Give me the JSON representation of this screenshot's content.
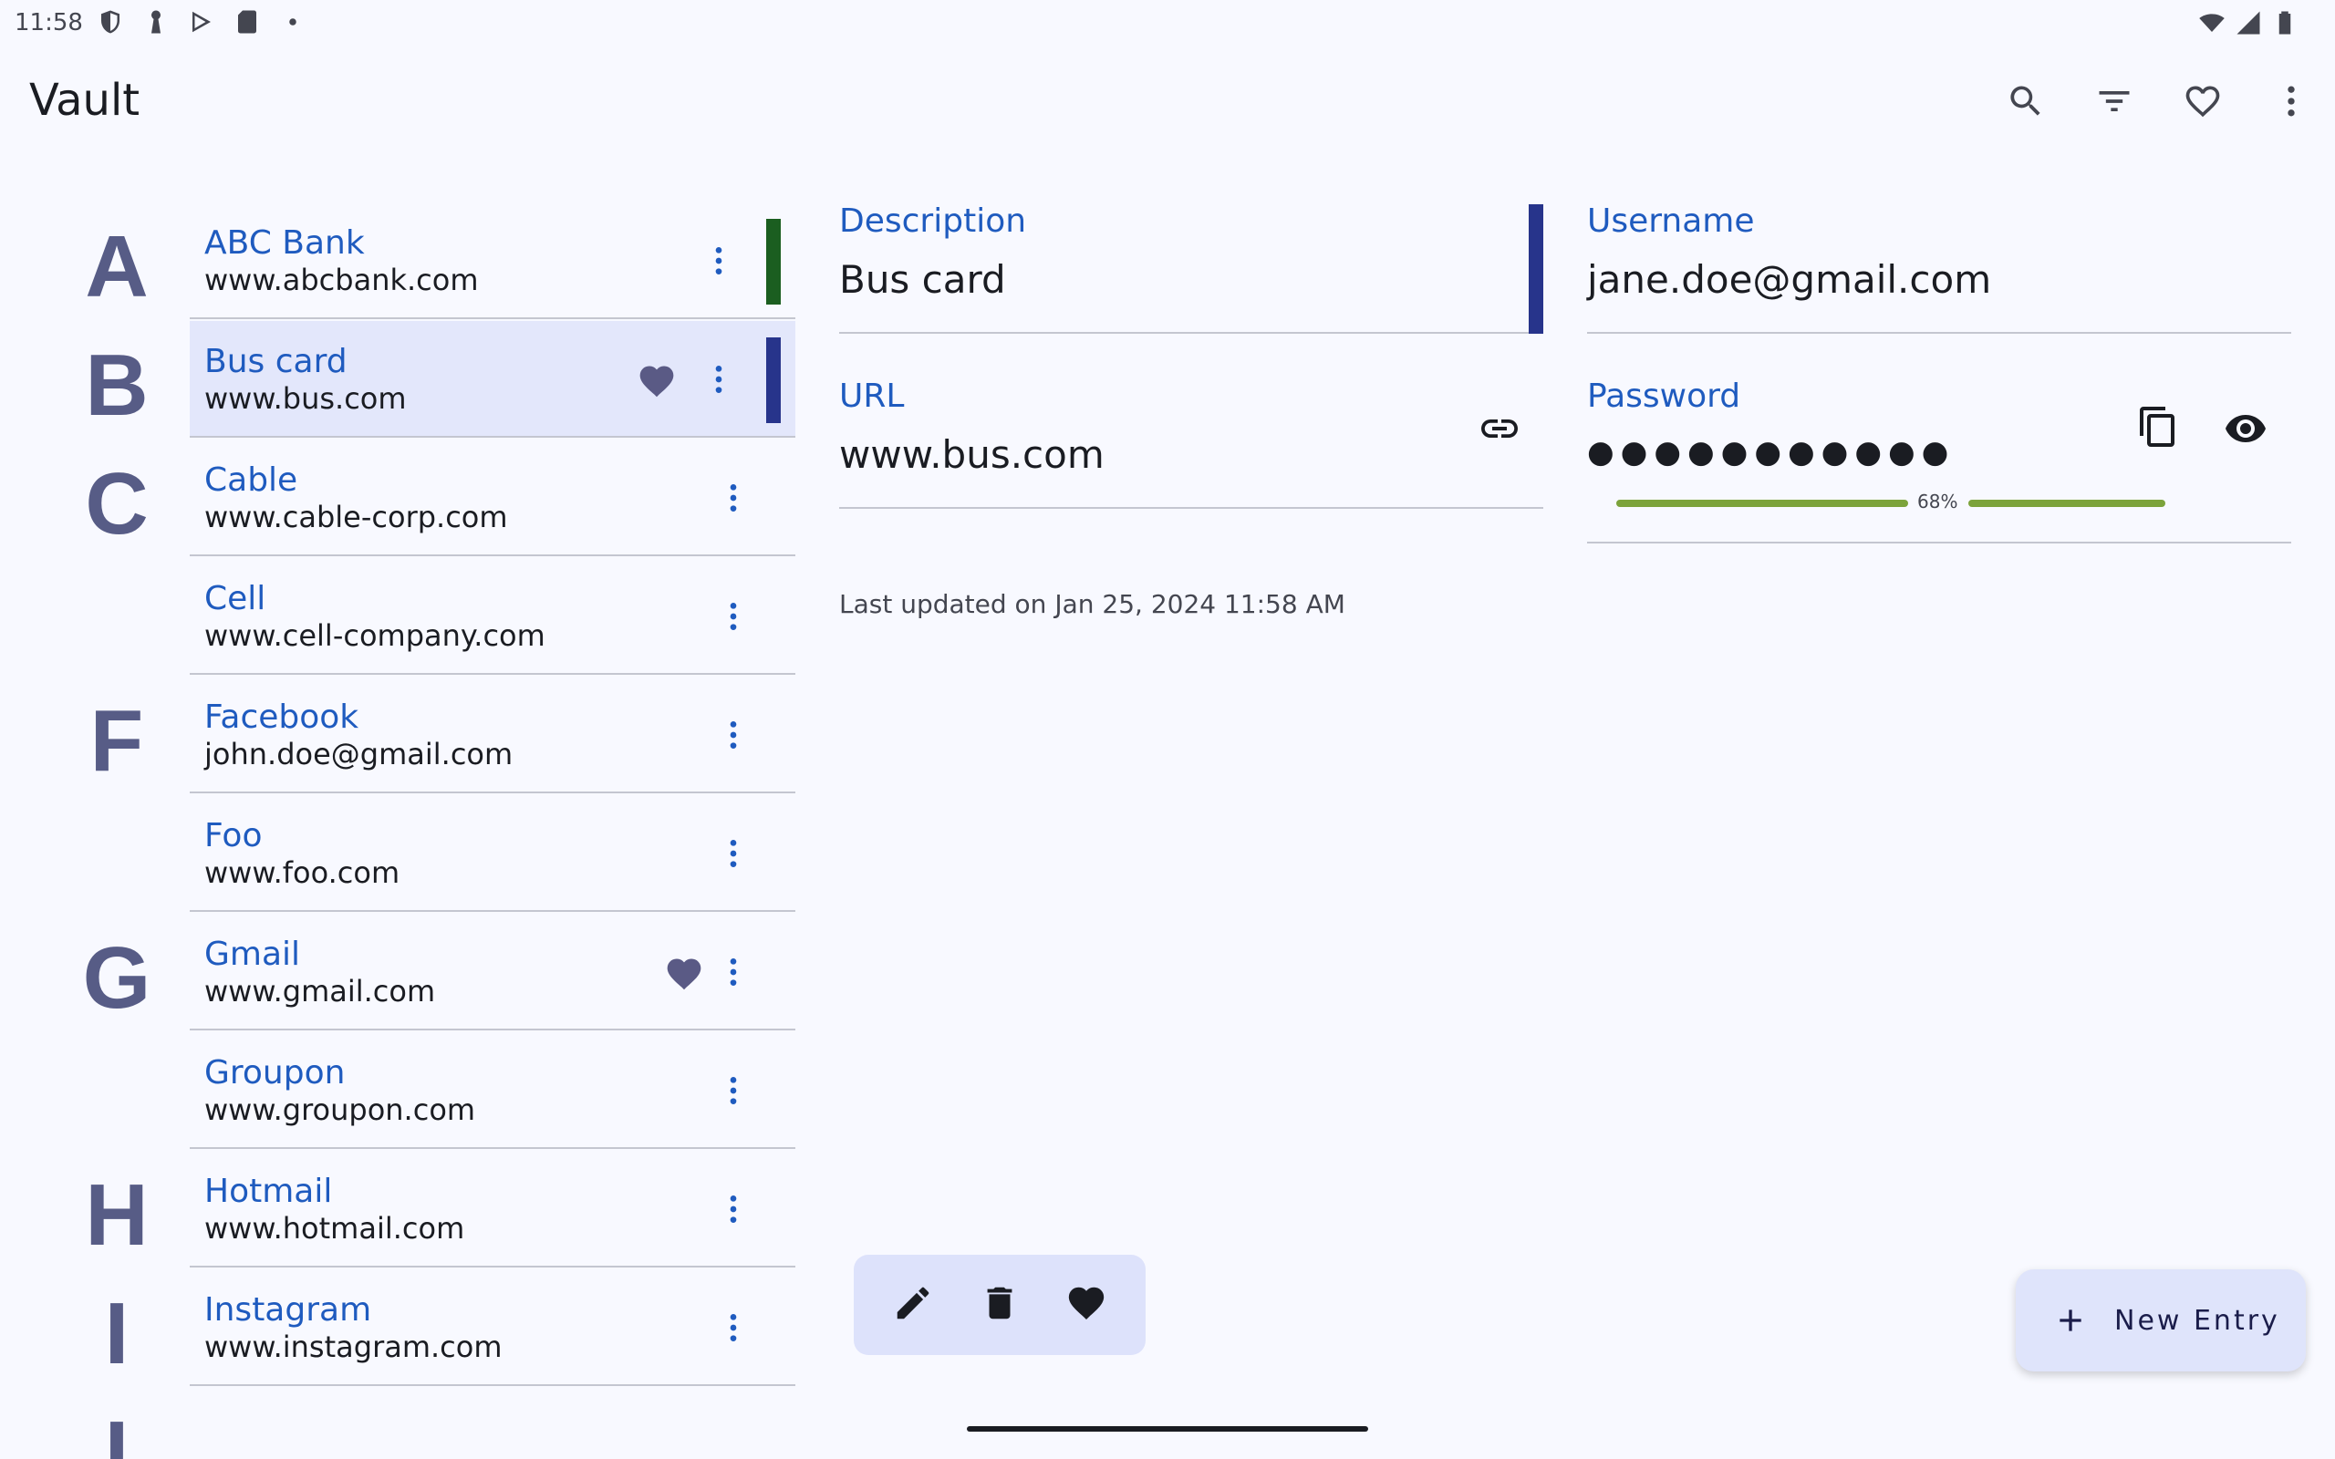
{
  "status": {
    "time": "11:58"
  },
  "app": {
    "title": "Vault"
  },
  "entries": [
    {
      "letter": "A",
      "name": "ABC Bank",
      "url": "www.abcbank.com",
      "favorite": false,
      "color": "#1b5e20",
      "selected": false
    },
    {
      "letter": "B",
      "name": "Bus card",
      "url": "www.bus.com",
      "favorite": true,
      "color": "#27348b",
      "selected": true
    },
    {
      "letter": "C",
      "name": "Cable",
      "url": "www.cable-corp.com",
      "favorite": false,
      "color": null,
      "selected": false
    },
    {
      "letter": "",
      "name": "Cell",
      "url": "www.cell-company.com",
      "favorite": false,
      "color": null,
      "selected": false
    },
    {
      "letter": "F",
      "name": "Facebook",
      "url": "john.doe@gmail.com",
      "favorite": false,
      "color": null,
      "selected": false
    },
    {
      "letter": "",
      "name": "Foo",
      "url": "www.foo.com",
      "favorite": false,
      "color": null,
      "selected": false
    },
    {
      "letter": "G",
      "name": "Gmail",
      "url": "www.gmail.com",
      "favorite": true,
      "color": null,
      "selected": false
    },
    {
      "letter": "",
      "name": "Groupon",
      "url": "www.groupon.com",
      "favorite": false,
      "color": null,
      "selected": false
    },
    {
      "letter": "H",
      "name": "Hotmail",
      "url": "www.hotmail.com",
      "favorite": false,
      "color": null,
      "selected": false
    },
    {
      "letter": "I",
      "name": "Instagram",
      "url": "www.instagram.com",
      "favorite": false,
      "color": null,
      "selected": false
    },
    {
      "letter": "I",
      "name": "",
      "url": "",
      "favorite": false,
      "color": null,
      "selected": false
    }
  ],
  "detail": {
    "description_label": "Description",
    "description": "Bus card",
    "username_label": "Username",
    "username": "jane.doe@gmail.com",
    "url_label": "URL",
    "url": "www.bus.com",
    "password_label": "Password",
    "password_masked": "●●●●●●●●●●●",
    "strength_percent": 68,
    "strength_label": "68%",
    "last_updated": "Last updated on Jan 25, 2024 11:58 AM",
    "accent_color": "#27348b"
  },
  "fab": {
    "label": "New Entry"
  }
}
